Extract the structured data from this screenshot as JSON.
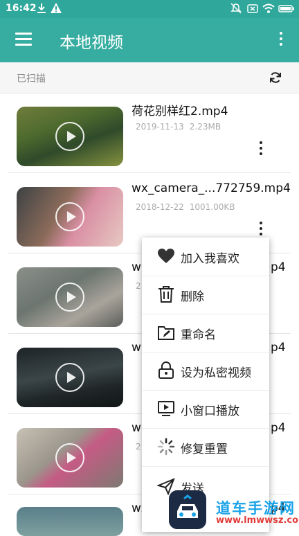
{
  "status_bar": {
    "time": "16:42",
    "icons": [
      "download-icon",
      "warning-icon",
      "mute-icon",
      "sim-off-icon",
      "wifi-icon",
      "battery-icon"
    ]
  },
  "app_bar": {
    "title": "本地视频",
    "bg_color": "#36ada0"
  },
  "scan_bar": {
    "status": "已扫描"
  },
  "videos": [
    {
      "name": "荷花别样红2.mp4",
      "date": "2019-11-13",
      "size": "2.23MB"
    },
    {
      "name": "wx_camera_...772759.mp4",
      "date": "2018-12-22",
      "size": "1001.00KB"
    },
    {
      "name": "w",
      "date": "2",
      "size": ""
    },
    {
      "name": "w",
      "date": "",
      "size": ""
    },
    {
      "name": "w",
      "date": "2",
      "size": ""
    },
    {
      "name": "wx_c",
      "date": "",
      "size": ""
    }
  ],
  "video_name_tails": [
    "",
    "",
    "p4",
    "p4",
    "p4",
    "p4"
  ],
  "menu": {
    "items": [
      {
        "label": "加入我喜欢",
        "icon": "heart-icon"
      },
      {
        "label": "删除",
        "icon": "trash-icon"
      },
      {
        "label": "重命名",
        "icon": "rename-folder-icon"
      },
      {
        "label": "设为私密视频",
        "icon": "lock-icon"
      },
      {
        "label": "小窗口播放",
        "icon": "pip-icon"
      },
      {
        "label": "修复重置",
        "icon": "loading-icon"
      },
      {
        "label": "发送",
        "icon": "send-icon"
      }
    ]
  },
  "watermark": {
    "title": "道车手游网",
    "url": "www.lmwwsz.com"
  }
}
